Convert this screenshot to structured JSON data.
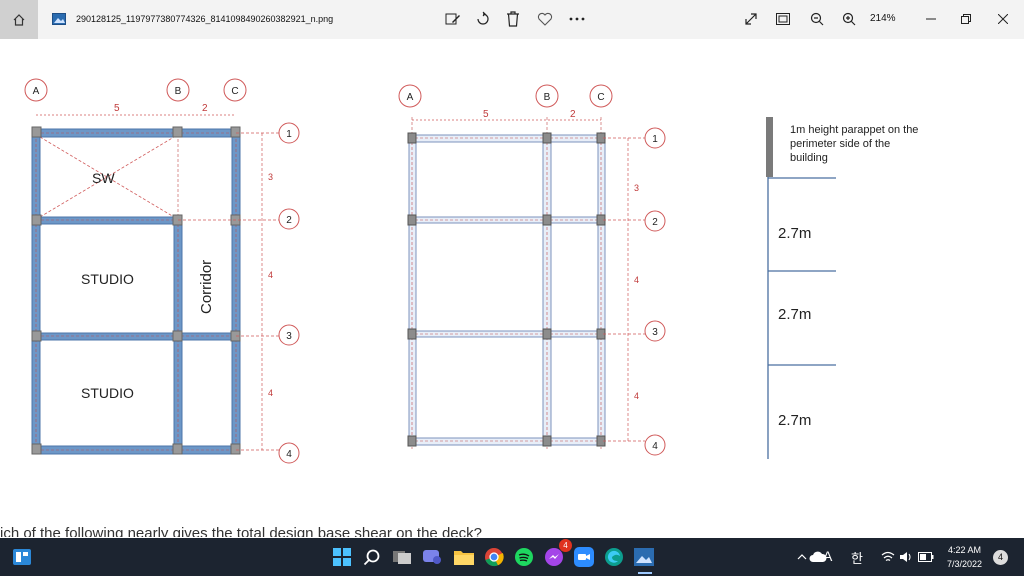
{
  "titlebar": {
    "file_name": "290128125_1197977380774326_8141098490260382921_n.png",
    "zoom": "214%"
  },
  "plan1": {
    "cols": [
      "A",
      "B",
      "C"
    ],
    "col_spans": [
      "5",
      "2"
    ],
    "rows": [
      "1",
      "2",
      "3",
      "4"
    ],
    "row_spans": [
      "3",
      "4",
      "4"
    ],
    "rooms": {
      "sw": "SW",
      "studio_1": "STUDIO",
      "studio_2": "STUDIO",
      "corridor": "Corridor"
    }
  },
  "plan2": {
    "cols": [
      "A",
      "B",
      "C"
    ],
    "col_spans": [
      "5",
      "2"
    ],
    "rows": [
      "1",
      "2",
      "3",
      "4"
    ],
    "row_spans": [
      "3",
      "4",
      "4"
    ]
  },
  "elevation": {
    "parapet_note": "1m height parappet on the perimeter side of the building",
    "storeys": [
      "2.7m",
      "2.7m",
      "2.7m"
    ]
  },
  "question": "ich of the following nearly gives the total design base shear on the deck?",
  "taskbar": {
    "notification_badge": "4",
    "ime_a": "A",
    "ime_han": "한",
    "time": "4:22 AM",
    "date": "7/3/2022",
    "notif_count": "4"
  }
}
